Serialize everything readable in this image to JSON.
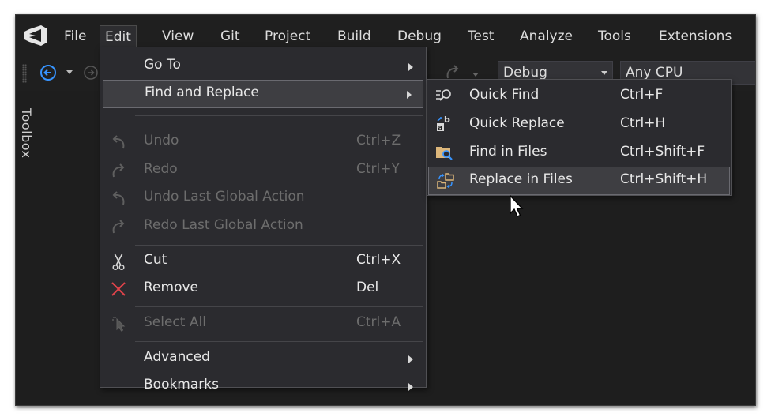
{
  "menubar": {
    "items": [
      {
        "label": "File"
      },
      {
        "label": "Edit"
      },
      {
        "label": "View"
      },
      {
        "label": "Git"
      },
      {
        "label": "Project"
      },
      {
        "label": "Build"
      },
      {
        "label": "Debug"
      },
      {
        "label": "Test"
      },
      {
        "label": "Analyze"
      },
      {
        "label": "Tools"
      },
      {
        "label": "Extensions"
      }
    ]
  },
  "toolbar": {
    "configuration": "Debug",
    "platform": "Any CPU"
  },
  "toolbox": {
    "label": "Toolbox"
  },
  "edit_menu": {
    "items": [
      {
        "label": "Go To",
        "shortcut": "",
        "enabled": true,
        "submenu": true,
        "icon": "none"
      },
      {
        "label": "Find and Replace",
        "shortcut": "",
        "enabled": true,
        "submenu": true,
        "highlighted": true,
        "icon": "none"
      },
      {
        "label": "Undo",
        "shortcut": "Ctrl+Z",
        "enabled": false,
        "icon": "undo-icon"
      },
      {
        "label": "Redo",
        "shortcut": "Ctrl+Y",
        "enabled": false,
        "icon": "redo-icon"
      },
      {
        "label": "Undo Last Global Action",
        "shortcut": "",
        "enabled": false,
        "icon": "undo-icon"
      },
      {
        "label": "Redo Last Global Action",
        "shortcut": "",
        "enabled": false,
        "icon": "redo-icon"
      },
      {
        "label": "Cut",
        "shortcut": "Ctrl+X",
        "enabled": true,
        "icon": "scissors-icon"
      },
      {
        "label": "Remove",
        "shortcut": "Del",
        "enabled": true,
        "icon": "remove-x-icon"
      },
      {
        "label": "Select All",
        "shortcut": "Ctrl+A",
        "enabled": false,
        "icon": "select-all-icon"
      },
      {
        "label": "Advanced",
        "shortcut": "",
        "enabled": true,
        "submenu": true,
        "icon": "none"
      },
      {
        "label": "Bookmarks",
        "shortcut": "",
        "enabled": true,
        "submenu": true,
        "icon": "none"
      }
    ]
  },
  "find_replace_menu": {
    "items": [
      {
        "label": "Quick Find",
        "shortcut": "Ctrl+F",
        "icon": "quick-find-icon"
      },
      {
        "label": "Quick Replace",
        "shortcut": "Ctrl+H",
        "icon": "quick-replace-icon"
      },
      {
        "label": "Find in Files",
        "shortcut": "Ctrl+Shift+F",
        "icon": "find-in-files-icon"
      },
      {
        "label": "Replace in Files",
        "shortcut": "Ctrl+Shift+H",
        "icon": "replace-in-files-icon",
        "highlighted": true
      }
    ]
  },
  "colors": {
    "background": "#1e1e1e",
    "menu_background": "#2b2b2f",
    "highlight": "#3e3e42",
    "accent_blue": "#3794ff",
    "remove_red": "#e0434a",
    "vs_purple": "#ffffff"
  }
}
